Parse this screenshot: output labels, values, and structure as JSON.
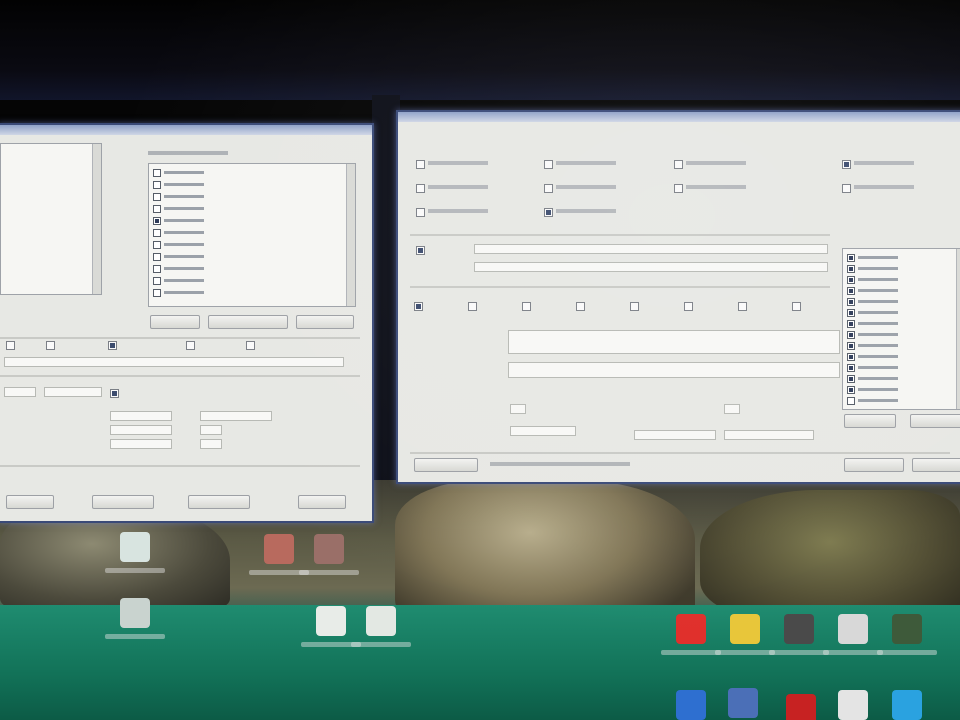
{
  "window_left": {
    "title": "",
    "nav_list_items": [
      {
        "label": "",
        "checked": false
      },
      {
        "label": "",
        "checked": false
      },
      {
        "label": "",
        "checked": false
      },
      {
        "label": "",
        "checked": false
      }
    ],
    "tree_items": [
      {
        "label": "",
        "checked": false
      },
      {
        "label": "",
        "checked": false
      },
      {
        "label": "",
        "checked": false
      },
      {
        "label": "",
        "checked": false
      },
      {
        "label": "",
        "checked": true
      },
      {
        "label": "",
        "checked": false
      },
      {
        "label": "",
        "checked": false
      },
      {
        "label": "",
        "checked": false
      },
      {
        "label": "",
        "checked": false
      },
      {
        "label": "",
        "checked": false
      },
      {
        "label": "",
        "checked": false
      }
    ],
    "buttons": [
      "",
      "",
      "",
      "",
      ""
    ],
    "status": ""
  },
  "window_right": {
    "title": "",
    "options": [
      {
        "label": "",
        "checked": false
      },
      {
        "label": "",
        "checked": false
      },
      {
        "label": "",
        "checked": false
      },
      {
        "label": "",
        "checked": true
      },
      {
        "label": "",
        "checked": false
      },
      {
        "label": "",
        "checked": false
      },
      {
        "label": "",
        "checked": false
      },
      {
        "label": "",
        "checked": false
      },
      {
        "label": "",
        "checked": false
      },
      {
        "label": "",
        "checked": true
      }
    ],
    "side_list_items": [
      {
        "label": "",
        "checked": true
      },
      {
        "label": "",
        "checked": true
      },
      {
        "label": "",
        "checked": true
      },
      {
        "label": "",
        "checked": true
      },
      {
        "label": "",
        "checked": true
      },
      {
        "label": "",
        "checked": true
      },
      {
        "label": "",
        "checked": true
      },
      {
        "label": "",
        "checked": true
      },
      {
        "label": "",
        "checked": true
      },
      {
        "label": "",
        "checked": true
      },
      {
        "label": "",
        "checked": true
      },
      {
        "label": "",
        "checked": true
      },
      {
        "label": "",
        "checked": true
      },
      {
        "label": "",
        "checked": false
      }
    ],
    "buttons": [
      "",
      "",
      "",
      ""
    ],
    "status": ""
  },
  "desktop": {
    "icons": [
      {
        "name": "recycle-bin-icon",
        "label": "",
        "color": "#d8e4e0"
      },
      {
        "name": "app-shortcut-icon",
        "label": "",
        "color": "#c9d3cf"
      },
      {
        "name": "photo-app-icon",
        "label": "",
        "color": "#b86a5e"
      },
      {
        "name": "photo-app-icon-2",
        "label": "",
        "color": "#9a6f68"
      },
      {
        "name": "document-icon",
        "label": "",
        "color": "#e8ece8"
      },
      {
        "name": "document-icon-2",
        "label": "",
        "color": "#e3e8e3"
      },
      {
        "name": "red-app-icon",
        "label": "",
        "color": "#e0302c"
      },
      {
        "name": "yellow-app-icon",
        "label": "",
        "color": "#e8c63a"
      },
      {
        "name": "game-icon",
        "label": "",
        "color": "#4a4a4a"
      },
      {
        "name": "disc-icon",
        "label": "",
        "color": "#d8d8d8"
      },
      {
        "name": "green-app-icon",
        "label": "",
        "color": "#3e5a3a"
      },
      {
        "name": "blue-app-icon",
        "label": "",
        "color": "#2e6fd0"
      },
      {
        "name": "folder-app-icon",
        "label": "",
        "color": "#4b6fb7"
      },
      {
        "name": "red-dot-icon",
        "label": "",
        "color": "#c72222"
      },
      {
        "name": "pin-icon",
        "label": "",
        "color": "#e4e4e4"
      },
      {
        "name": "skype-icon",
        "label": "",
        "color": "#2aa2e0"
      }
    ]
  },
  "colors": {
    "window_bg": "#e7e8e4",
    "window_border": "#3a4a78",
    "sea": "#1e7a63"
  }
}
